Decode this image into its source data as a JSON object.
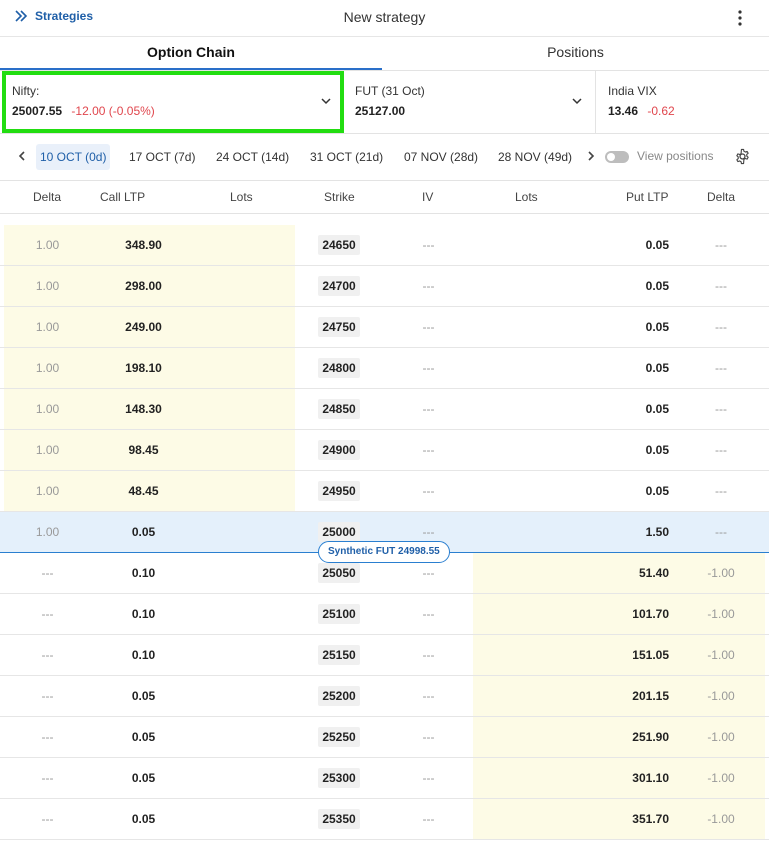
{
  "header": {
    "back_label": "Strategies",
    "title": "New strategy"
  },
  "tabs": [
    {
      "label": "Option Chain",
      "active": true
    },
    {
      "label": "Positions",
      "active": false
    }
  ],
  "instruments": {
    "nifty": {
      "name": "Nifty:",
      "price": "25007.55",
      "change": "-12.00 (-0.05%)"
    },
    "fut": {
      "name": "FUT (31 Oct)",
      "price": "25127.00"
    },
    "vix": {
      "name": "India VIX",
      "price": "13.46",
      "change": "-0.62"
    }
  },
  "expiries": [
    {
      "date": "10 OCT",
      "days": "(0d)",
      "active": true
    },
    {
      "date": "17 OCT",
      "days": "(7d)",
      "active": false
    },
    {
      "date": "24 OCT",
      "days": "(14d)",
      "active": false
    },
    {
      "date": "31 OCT",
      "days": "(21d)",
      "active": false
    },
    {
      "date": "07 NOV",
      "days": "(28d)",
      "active": false
    },
    {
      "date": "28 NOV",
      "days": "(49d)",
      "active": false
    }
  ],
  "view_positions_label": "View positions",
  "columns": [
    "Delta",
    "Call LTP",
    "Lots",
    "Strike",
    "IV",
    "Lots",
    "Put LTP",
    "Delta"
  ],
  "synthetic_fut": "Synthetic FUT 24998.55",
  "rows": [
    {
      "call_delta": "1.00",
      "call_ltp": "348.90",
      "strike": "24650",
      "iv": "---",
      "put_ltp": "0.05",
      "put_delta": "---",
      "itm": "call"
    },
    {
      "call_delta": "1.00",
      "call_ltp": "298.00",
      "strike": "24700",
      "iv": "---",
      "put_ltp": "0.05",
      "put_delta": "---",
      "itm": "call"
    },
    {
      "call_delta": "1.00",
      "call_ltp": "249.00",
      "strike": "24750",
      "iv": "---",
      "put_ltp": "0.05",
      "put_delta": "---",
      "itm": "call"
    },
    {
      "call_delta": "1.00",
      "call_ltp": "198.10",
      "strike": "24800",
      "iv": "---",
      "put_ltp": "0.05",
      "put_delta": "---",
      "itm": "call"
    },
    {
      "call_delta": "1.00",
      "call_ltp": "148.30",
      "strike": "24850",
      "iv": "---",
      "put_ltp": "0.05",
      "put_delta": "---",
      "itm": "call"
    },
    {
      "call_delta": "1.00",
      "call_ltp": "98.45",
      "strike": "24900",
      "iv": "---",
      "put_ltp": "0.05",
      "put_delta": "---",
      "itm": "call"
    },
    {
      "call_delta": "1.00",
      "call_ltp": "48.45",
      "strike": "24950",
      "iv": "---",
      "put_ltp": "0.05",
      "put_delta": "---",
      "itm": "call"
    },
    {
      "call_delta": "1.00",
      "call_ltp": "0.05",
      "strike": "25000",
      "iv": "---",
      "put_ltp": "1.50",
      "put_delta": "---",
      "itm": "atm"
    },
    {
      "call_delta": "---",
      "call_ltp": "0.10",
      "strike": "25050",
      "iv": "---",
      "put_ltp": "51.40",
      "put_delta": "-1.00",
      "itm": "put"
    },
    {
      "call_delta": "---",
      "call_ltp": "0.10",
      "strike": "25100",
      "iv": "---",
      "put_ltp": "101.70",
      "put_delta": "-1.00",
      "itm": "put"
    },
    {
      "call_delta": "---",
      "call_ltp": "0.10",
      "strike": "25150",
      "iv": "---",
      "put_ltp": "151.05",
      "put_delta": "-1.00",
      "itm": "put"
    },
    {
      "call_delta": "---",
      "call_ltp": "0.05",
      "strike": "25200",
      "iv": "---",
      "put_ltp": "201.15",
      "put_delta": "-1.00",
      "itm": "put"
    },
    {
      "call_delta": "---",
      "call_ltp": "0.05",
      "strike": "25250",
      "iv": "---",
      "put_ltp": "251.90",
      "put_delta": "-1.00",
      "itm": "put"
    },
    {
      "call_delta": "---",
      "call_ltp": "0.05",
      "strike": "25300",
      "iv": "---",
      "put_ltp": "301.10",
      "put_delta": "-1.00",
      "itm": "put"
    },
    {
      "call_delta": "---",
      "call_ltp": "0.05",
      "strike": "25350",
      "iv": "---",
      "put_ltp": "351.70",
      "put_delta": "-1.00",
      "itm": "put"
    }
  ]
}
